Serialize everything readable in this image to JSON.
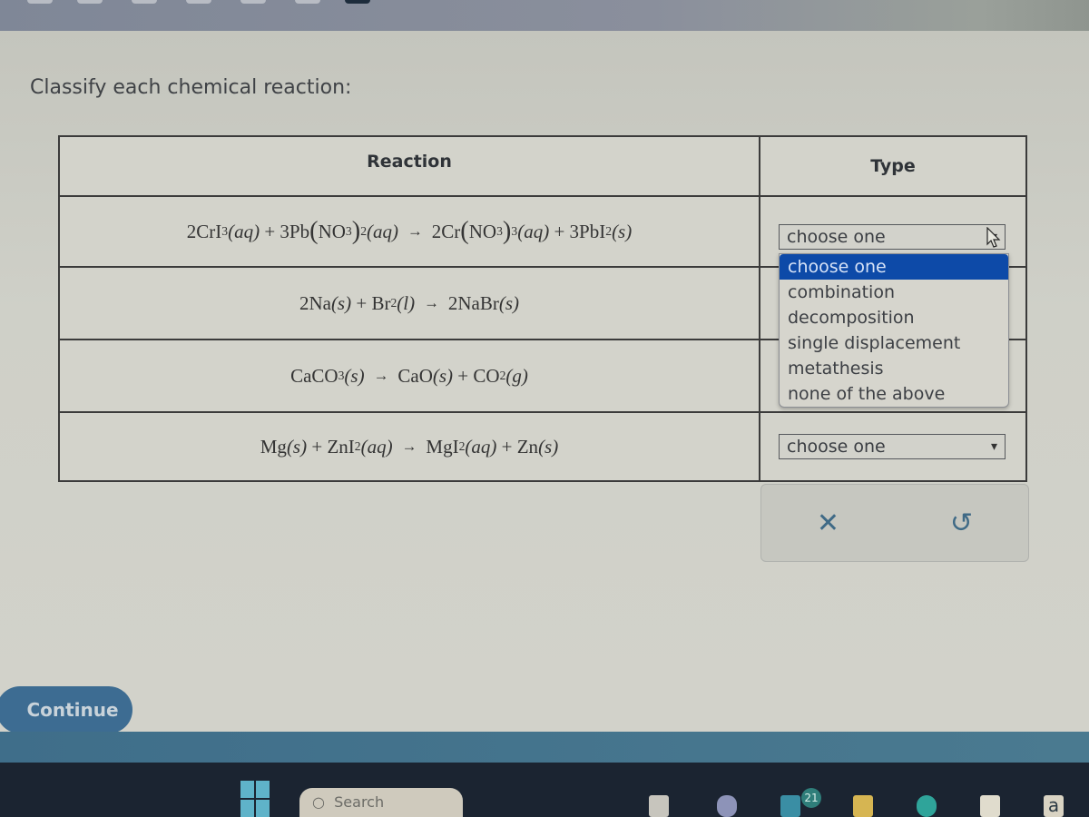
{
  "prompt": "Classify each chemical reaction:",
  "table": {
    "headers": {
      "reaction": "Reaction",
      "type": "Type"
    },
    "rows": [
      {
        "reaction_text": "2CrI3(aq) + 3Pb(NO3)2(aq) → 2Cr(NO3)3(aq) + 3PbI2(s)",
        "parts": {
          "a": "2CrI",
          "a_sub": "3",
          "a_state": "(aq)",
          "b": "3Pb",
          "b_inner": "NO",
          "b_inner_sub": "3",
          "b_sub": "2",
          "b_state": "(aq)",
          "c": "2Cr",
          "c_inner": "NO",
          "c_inner_sub": "3",
          "c_sub": "3",
          "c_state": "(aq)",
          "d": "3PbI",
          "d_sub": "2",
          "d_state": "(s)"
        },
        "type_value": "choose one",
        "dropdown_open": true
      },
      {
        "reaction_text": "2Na(s) + Br2(l) → 2NaBr(s)",
        "parts": {
          "a": "2Na",
          "a_state": "(s)",
          "b": "Br",
          "b_sub": "2",
          "b_state": "(l)",
          "c": "2NaBr",
          "c_state": "(s)"
        },
        "type_value": "choose one"
      },
      {
        "reaction_text": "CaCO3(s) → CaO(s) + CO2(g)",
        "parts": {
          "a": "CaCO",
          "a_sub": "3",
          "a_state": "(s)",
          "b": "CaO",
          "b_state": "(s)",
          "c": "CO",
          "c_sub": "2",
          "c_state": "(g)"
        },
        "type_value": "choose one"
      },
      {
        "reaction_text": "Mg(s) + ZnI2(aq) → MgI2(aq) + Zn(s)",
        "parts": {
          "a": "Mg",
          "a_state": "(s)",
          "b": "ZnI",
          "b_sub": "2",
          "b_state": "(aq)",
          "c": "MgI",
          "c_sub": "2",
          "c_state": "(aq)",
          "d": "Zn",
          "d_state": "(s)"
        },
        "type_value": "choose one"
      }
    ]
  },
  "symbols": {
    "plus": "+",
    "arrow": "→",
    "lparen": "(",
    "rparen": ")"
  },
  "dropdown": {
    "options": [
      "choose one",
      "combination",
      "decomposition",
      "single displacement",
      "metathesis",
      "none of the above"
    ],
    "highlighted": "choose one"
  },
  "actions": {
    "clear_icon": "✕",
    "undo_icon": "↺"
  },
  "continue_label": "Continue",
  "taskbar": {
    "search_placeholder": "Search",
    "notification_count": "21",
    "store_letter": "a"
  },
  "colors": {
    "accent": "#0d4aa8",
    "continue_button": "#3d6c92",
    "action_icon": "#3f6a86"
  }
}
